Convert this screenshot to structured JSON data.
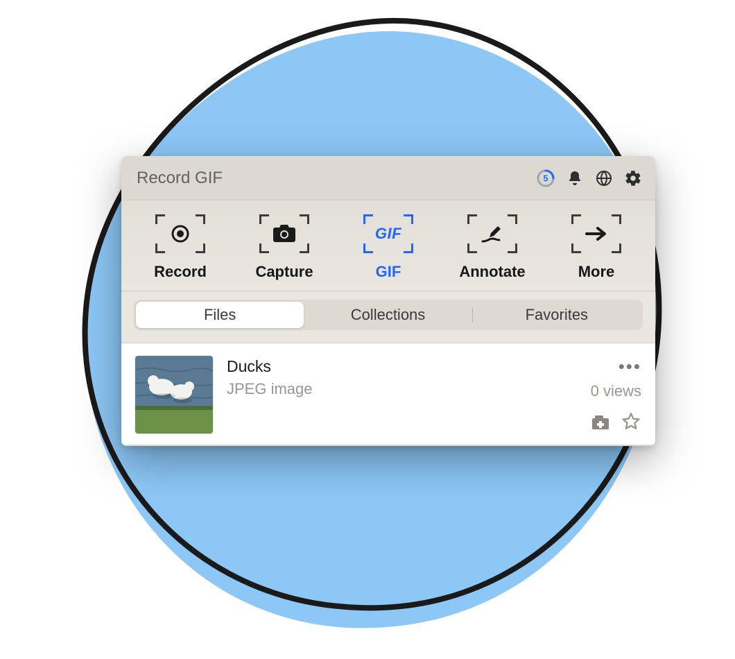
{
  "header": {
    "title": "Record GIF",
    "countdown_value": "5"
  },
  "toolbar": {
    "items": [
      {
        "label": "Record",
        "active": false
      },
      {
        "label": "Capture",
        "active": false
      },
      {
        "label": "GIF",
        "active": true
      },
      {
        "label": "Annotate",
        "active": false
      },
      {
        "label": "More",
        "active": false
      }
    ]
  },
  "tabs": {
    "items": [
      {
        "label": "Files",
        "active": true
      },
      {
        "label": "Collections",
        "active": false
      },
      {
        "label": "Favorites",
        "active": false
      }
    ]
  },
  "files": [
    {
      "name": "Ducks",
      "type_label": "JPEG image",
      "views_label": "0 views"
    }
  ]
}
